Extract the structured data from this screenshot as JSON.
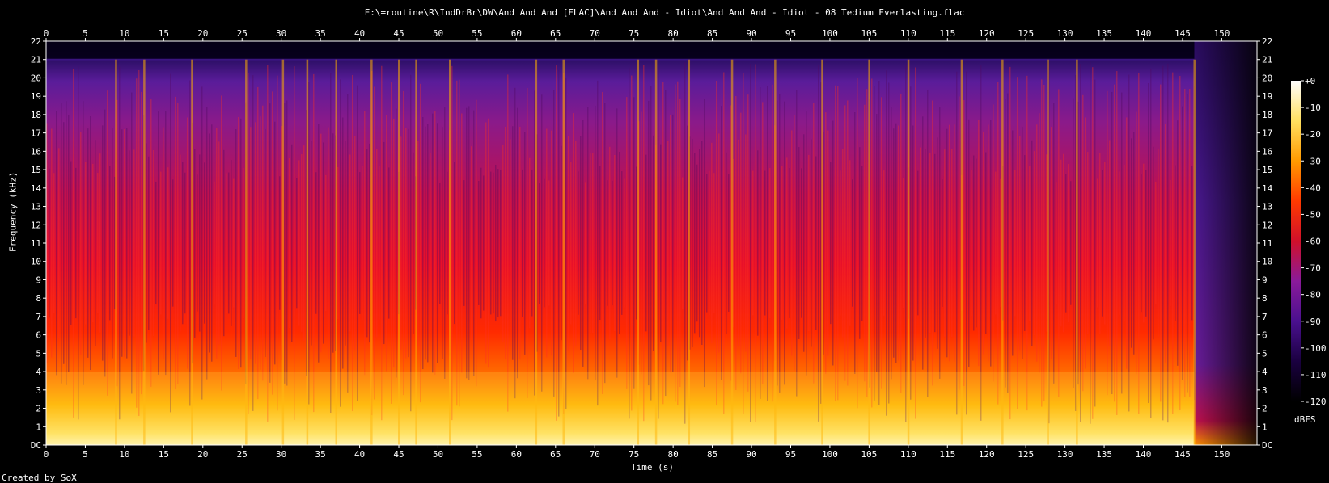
{
  "title": "F:\\=routine\\R\\IndDrBr\\DW\\And And And [FLAC]\\And And And - Idiot\\And And And - Idiot - 08 Tedium Everlasting.flac",
  "credit": "Created by SoX",
  "colorbar_unit": "dBFS",
  "chart_data": {
    "type": "heatmap",
    "title": "F:\\=routine\\R\\IndDrBr\\DW\\And And And [FLAC]\\And And And - Idiot\\And And And - Idiot - 08 Tedium Everlasting.flac",
    "xlabel": "Time (s)",
    "ylabel": "Frequency (kHz)",
    "xlim": [
      0,
      154.5
    ],
    "ylim": [
      0,
      22
    ],
    "x_ticks": [
      0,
      5,
      10,
      15,
      20,
      25,
      30,
      35,
      40,
      45,
      50,
      55,
      60,
      65,
      70,
      75,
      80,
      85,
      90,
      95,
      100,
      105,
      110,
      115,
      120,
      125,
      130,
      135,
      140,
      145,
      150
    ],
    "y_ticks": [
      "DC",
      "1",
      "2",
      "3",
      "4",
      "5",
      "6",
      "7",
      "8",
      "9",
      "10",
      "11",
      "12",
      "13",
      "14",
      "15",
      "16",
      "17",
      "18",
      "19",
      "20",
      "21",
      "22"
    ],
    "colorbar": {
      "label": "dBFS",
      "ticks": [
        "+0",
        "-10",
        "-20",
        "-30",
        "-40",
        "-50",
        "-60",
        "-70",
        "-80",
        "-90",
        "-100",
        "-110",
        "-120"
      ],
      "range": [
        -120,
        0
      ]
    },
    "colormap_stops": [
      "#000000",
      "#1a0040",
      "#4a108f",
      "#8a1a9a",
      "#d0102a",
      "#ff3a00",
      "#ff9a00",
      "#ffe060",
      "#ffffff"
    ],
    "content_end_s": 146.5,
    "lowpass_cutoff_khz": 21,
    "transient_times_s": [
      8.9,
      12.5,
      18.6,
      25.5,
      30.2,
      33.3,
      37.0,
      41.5,
      45.0,
      47.2,
      51.5,
      62.5,
      66.0,
      75.5,
      77.8,
      82.0,
      87.5,
      93.0,
      99.0,
      105.0,
      110.0,
      116.8,
      122.0,
      127.8,
      131.5,
      146.5
    ]
  }
}
